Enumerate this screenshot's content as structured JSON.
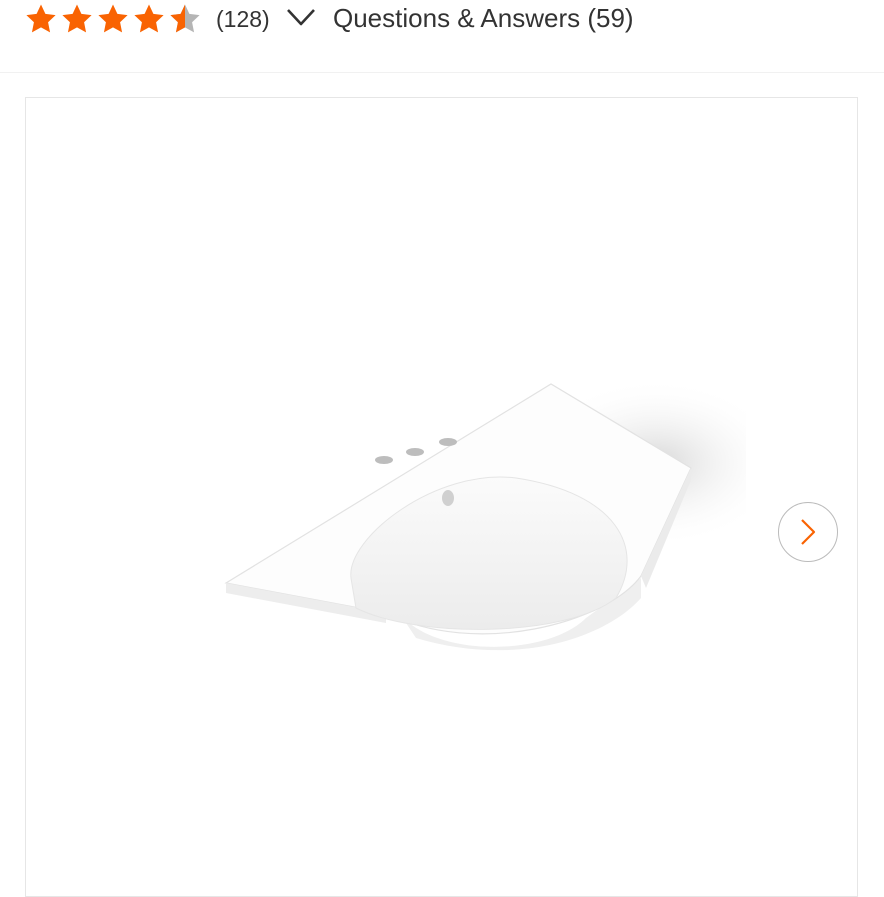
{
  "rating": {
    "value": 4.5,
    "max": 5,
    "review_count_label": "(128)",
    "star_color": "#f96302",
    "empty_star_color": "#b5b5b5"
  },
  "qa": {
    "label": "Questions & Answers (59)"
  },
  "gallery": {
    "image_icon": "bathroom-sink-image",
    "next_icon": "chevron-right-icon",
    "accent_color": "#f96302"
  }
}
